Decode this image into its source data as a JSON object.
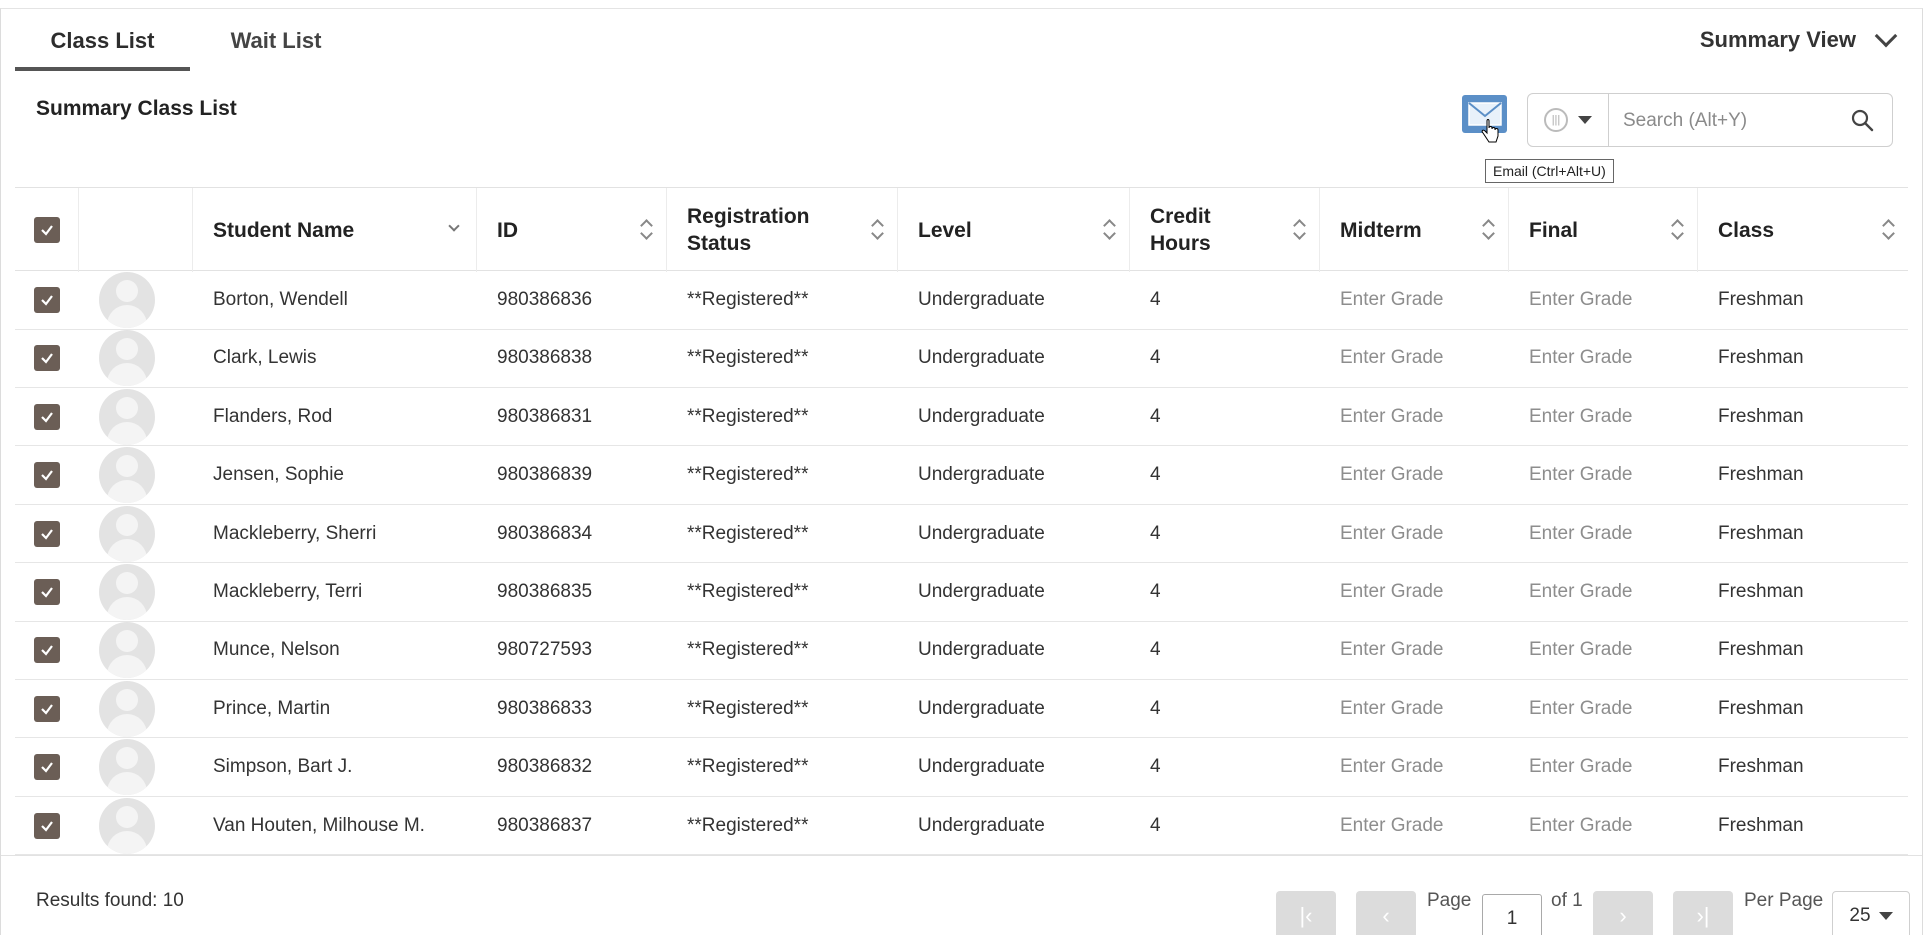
{
  "tabs": [
    {
      "label": "Class List",
      "active": true
    },
    {
      "label": "Wait List",
      "active": false
    }
  ],
  "view_selector": {
    "label": "Summary View"
  },
  "list_title": "Summary Class List",
  "toolbar": {
    "email_tooltip": "Email (Ctrl+Alt+U)",
    "search_placeholder": "Search (Alt+Y)"
  },
  "table": {
    "columns": [
      "Student Name",
      "ID",
      "Registration Status",
      "Level",
      "Credit Hours",
      "Midterm",
      "Final",
      "Class"
    ],
    "header_lines": {
      "registration_1": "Registration",
      "registration_2": "Status",
      "credit_1": "Credit",
      "credit_2": "Hours"
    },
    "rows": [
      {
        "name": "Borton, Wendell",
        "id": "980386836",
        "status": "**Registered**",
        "level": "Undergraduate",
        "credit": "4",
        "midterm": "Enter Grade",
        "final": "Enter Grade",
        "class": "Freshman"
      },
      {
        "name": "Clark, Lewis",
        "id": "980386838",
        "status": "**Registered**",
        "level": "Undergraduate",
        "credit": "4",
        "midterm": "Enter Grade",
        "final": "Enter Grade",
        "class": "Freshman"
      },
      {
        "name": "Flanders, Rod",
        "id": "980386831",
        "status": "**Registered**",
        "level": "Undergraduate",
        "credit": "4",
        "midterm": "Enter Grade",
        "final": "Enter Grade",
        "class": "Freshman"
      },
      {
        "name": "Jensen, Sophie",
        "id": "980386839",
        "status": "**Registered**",
        "level": "Undergraduate",
        "credit": "4",
        "midterm": "Enter Grade",
        "final": "Enter Grade",
        "class": "Freshman"
      },
      {
        "name": "Mackleberry, Sherri",
        "id": "980386834",
        "status": "**Registered**",
        "level": "Undergraduate",
        "credit": "4",
        "midterm": "Enter Grade",
        "final": "Enter Grade",
        "class": "Freshman"
      },
      {
        "name": "Mackleberry, Terri",
        "id": "980386835",
        "status": "**Registered**",
        "level": "Undergraduate",
        "credit": "4",
        "midterm": "Enter Grade",
        "final": "Enter Grade",
        "class": "Freshman"
      },
      {
        "name": "Munce, Nelson",
        "id": "980727593",
        "status": "**Registered**",
        "level": "Undergraduate",
        "credit": "4",
        "midterm": "Enter Grade",
        "final": "Enter Grade",
        "class": "Freshman"
      },
      {
        "name": "Prince, Martin",
        "id": "980386833",
        "status": "**Registered**",
        "level": "Undergraduate",
        "credit": "4",
        "midterm": "Enter Grade",
        "final": "Enter Grade",
        "class": "Freshman"
      },
      {
        "name": "Simpson, Bart J.",
        "id": "980386832",
        "status": "**Registered**",
        "level": "Undergraduate",
        "credit": "4",
        "midterm": "Enter Grade",
        "final": "Enter Grade",
        "class": "Freshman"
      },
      {
        "name": "Van Houten, Milhouse M.",
        "id": "980386837",
        "status": "**Registered**",
        "level": "Undergraduate",
        "credit": "4",
        "midterm": "Enter Grade",
        "final": "Enter Grade",
        "class": "Freshman"
      }
    ]
  },
  "footer": {
    "results": "Results found: 10",
    "page_label": "Page",
    "page_value": "1",
    "of_label": "of 1",
    "per_page_label": "Per Page",
    "per_page_value": "25"
  },
  "colors": {
    "checkbox": "#6b5e56",
    "email_button": "#5b8fc7",
    "disabled_button": "#dcdcdc"
  },
  "icons": [
    "envelope-icon",
    "column-chooser-icon",
    "search-icon",
    "checkmark-icon",
    "avatar-placeholder-icon",
    "first-page-icon",
    "prev-page-icon",
    "next-page-icon",
    "last-page-icon"
  ]
}
